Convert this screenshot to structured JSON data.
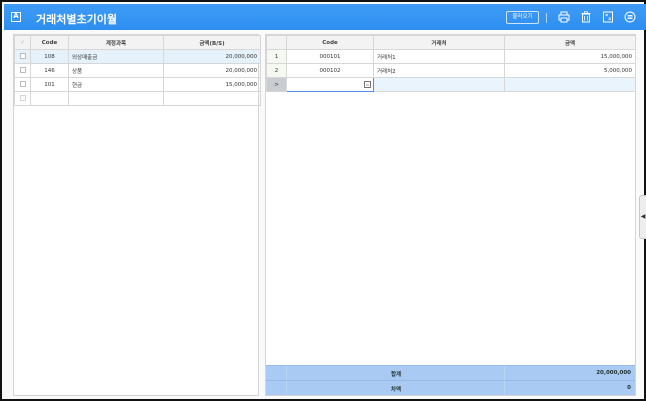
{
  "app": {
    "icon_letter": "A",
    "title": "거래처별초기이월",
    "load_button": "불러오기",
    "toolbar_icons": [
      "printer-icon",
      "trash-icon",
      "calculator-icon",
      "more-icon"
    ]
  },
  "left_grid": {
    "columns": [
      "Code",
      "계정과목",
      "금액(B/S)"
    ],
    "check_header": "✓",
    "rows": [
      {
        "code": "108",
        "account": "외상매출금",
        "amount": "20,000,000",
        "selected": true
      },
      {
        "code": "146",
        "account": "상품",
        "amount": "20,000,000",
        "selected": false
      },
      {
        "code": "101",
        "account": "현금",
        "amount": "15,000,000",
        "selected": false
      },
      {
        "code": "",
        "account": "",
        "amount": "",
        "selected": false
      }
    ]
  },
  "right_grid": {
    "columns": [
      "Code",
      "거래처",
      "금액"
    ],
    "rows": [
      {
        "num": "1",
        "code": "000101",
        "partner": "거래처1",
        "amount": "15,000,000"
      },
      {
        "num": "2",
        "code": "000102",
        "partner": "거래처2",
        "amount": "5,000,000"
      }
    ],
    "active_row_marker": ">",
    "summary": {
      "total_label": "합계",
      "total_value": "20,000,000",
      "diff_label": "차액",
      "diff_value": "0"
    }
  },
  "side_tab_glyph": "◀"
}
